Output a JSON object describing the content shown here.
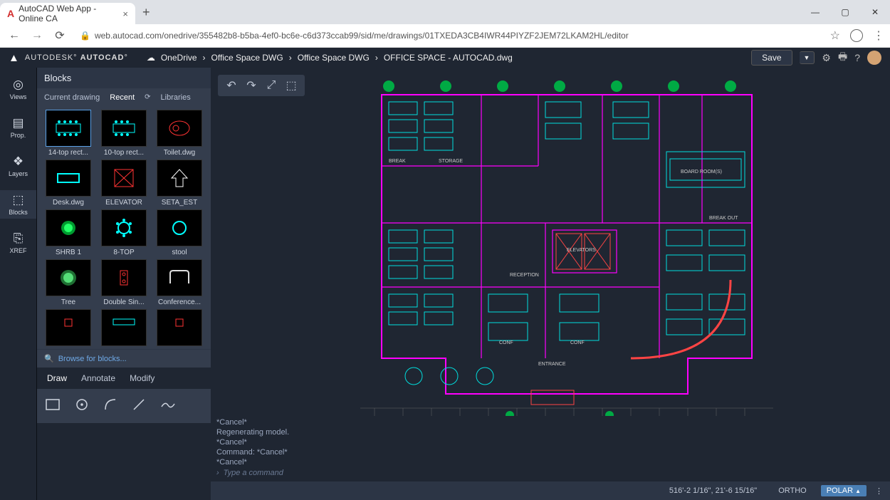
{
  "browser": {
    "tab_title": "AutoCAD Web App - Online CA",
    "url": "web.autocad.com/onedrive/355482b8-b5ba-4ef0-bc6e-c6d373ccab99/sid/me/drawings/01TXEDA3CB4IWR44PIYZF2JEM72LKAM2HL/editor"
  },
  "header": {
    "brand_prefix": "AUTODESK",
    "brand_product": "AUTOCAD",
    "breadcrumb": [
      "OneDrive",
      "Office Space DWG",
      "Office Space DWG",
      "OFFICE SPACE - AUTOCAD.dwg"
    ],
    "save_label": "Save"
  },
  "rail": [
    {
      "icon": "views",
      "label": "Views"
    },
    {
      "icon": "prop",
      "label": "Prop."
    },
    {
      "icon": "layers",
      "label": "Layers"
    },
    {
      "icon": "blocks",
      "label": "Blocks"
    },
    {
      "icon": "xref",
      "label": "XREF"
    }
  ],
  "panel": {
    "title": "Blocks",
    "tabs": [
      "Current drawing",
      "Recent",
      "Libraries"
    ],
    "active_tab": 1,
    "browse_label": "Browse for blocks...",
    "blocks": [
      {
        "label": "14-top rect..."
      },
      {
        "label": "10-top rect..."
      },
      {
        "label": "Toilet.dwg"
      },
      {
        "label": "Desk.dwg"
      },
      {
        "label": "ELEVATOR"
      },
      {
        "label": "SETA_EST"
      },
      {
        "label": "SHRB 1"
      },
      {
        "label": "8-TOP"
      },
      {
        "label": "stool"
      },
      {
        "label": "Tree"
      },
      {
        "label": "Double Sin..."
      },
      {
        "label": "Conference..."
      }
    ]
  },
  "bottom_tabs": [
    "Draw",
    "Annotate",
    "Modify"
  ],
  "command_log": [
    "*Cancel*",
    "Regenerating model.",
    "*Cancel*",
    "Command: *Cancel*",
    "*Cancel*"
  ],
  "command_placeholder": "Type a command",
  "status": {
    "coords": "516'-2 1/16\", 21'-6 15/16\"",
    "ortho": "ORTHO",
    "polar": "POLAR"
  },
  "floorplan_labels": {
    "break": "BREAK",
    "storage": "STORAGE",
    "elevators": "ELEVATORS",
    "reception": "RECEPTION",
    "boardroom": "BOARD ROOM(S)",
    "breakout": "BREAK OUT",
    "entrance": "ENTRANCE",
    "conf": "CONF"
  }
}
